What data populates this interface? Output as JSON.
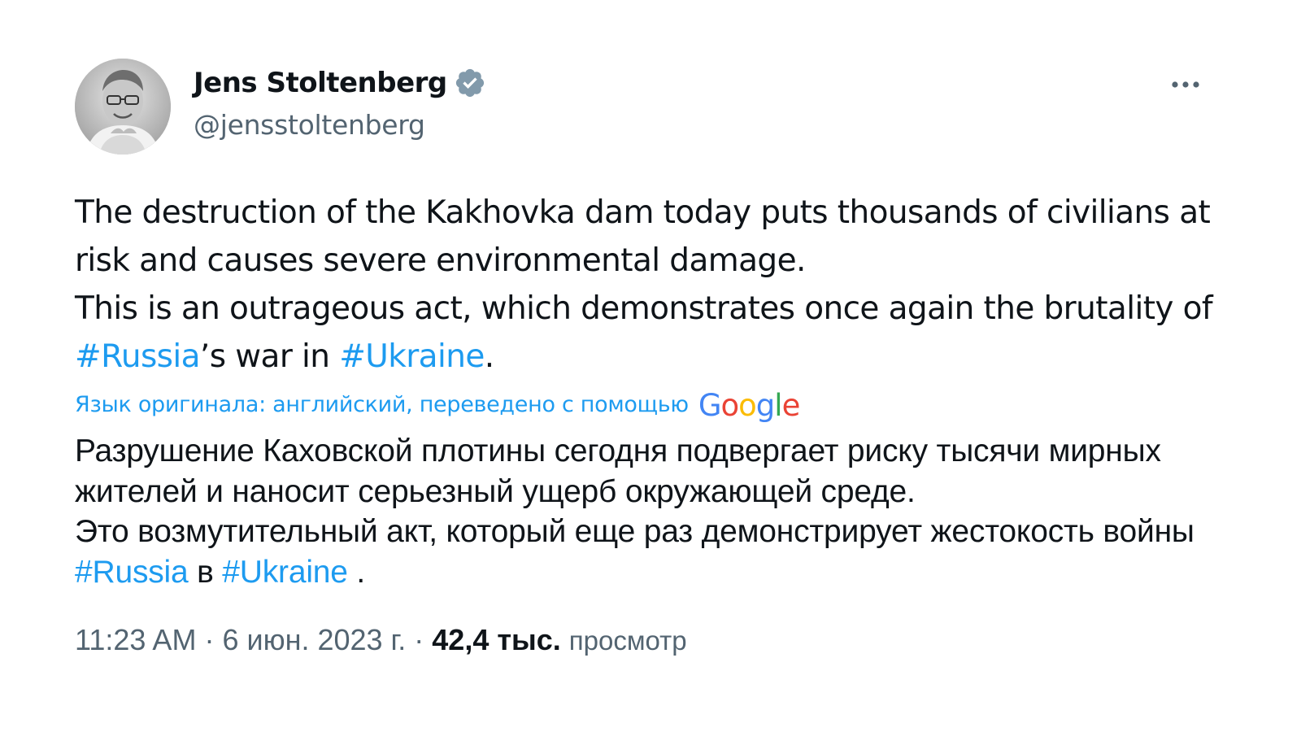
{
  "author": {
    "display_name": "Jens Stoltenberg",
    "handle": "@jensstoltenberg",
    "verified_badge_icon": "verified-badge-icon",
    "badge_color": "#829aab"
  },
  "menu": {
    "more_icon": "more-horizontal-icon"
  },
  "tweet": {
    "en": {
      "p1": "The destruction of the Kakhovka dam today puts thousands of civilians at risk and causes severe environmental damage.",
      "p2_prefix": "This is an outrageous act, which demonstrates once again the brutality of ",
      "hashtag_russia": "#Russia",
      "p2_middle": "’s war in ",
      "hashtag_ukraine": "#Ukraine",
      "p2_suffix": "."
    },
    "translation_note": "Язык оригинала: английский, переведено с помощью",
    "translation_provider": "Google",
    "ru": {
      "p1": "Разрушение Каховской плотины сегодня подвергает риску тысячи мирных жителей и наносит серьезный ущерб окружающей среде.",
      "p2_prefix": "Это возмутительный акт, который еще раз демонстрирует жестокость войны ",
      "hashtag_russia": "#Russia",
      "p2_middle": " в ",
      "hashtag_ukraine": "#Ukraine",
      "p2_suffix": " ."
    }
  },
  "meta": {
    "time": "11:23 AM",
    "sep1": " · ",
    "date": "6 июн. 2023 г.",
    "sep2": " · ",
    "views_count": "42,4 тыс.",
    "views_label": "просмотр"
  },
  "colors": {
    "link": "#1d9bf0",
    "text": "#0f1419",
    "secondary": "#536471",
    "google_blue": "#4285f4",
    "google_red": "#ea4335",
    "google_yellow": "#fbbc05",
    "google_green": "#34a853"
  }
}
